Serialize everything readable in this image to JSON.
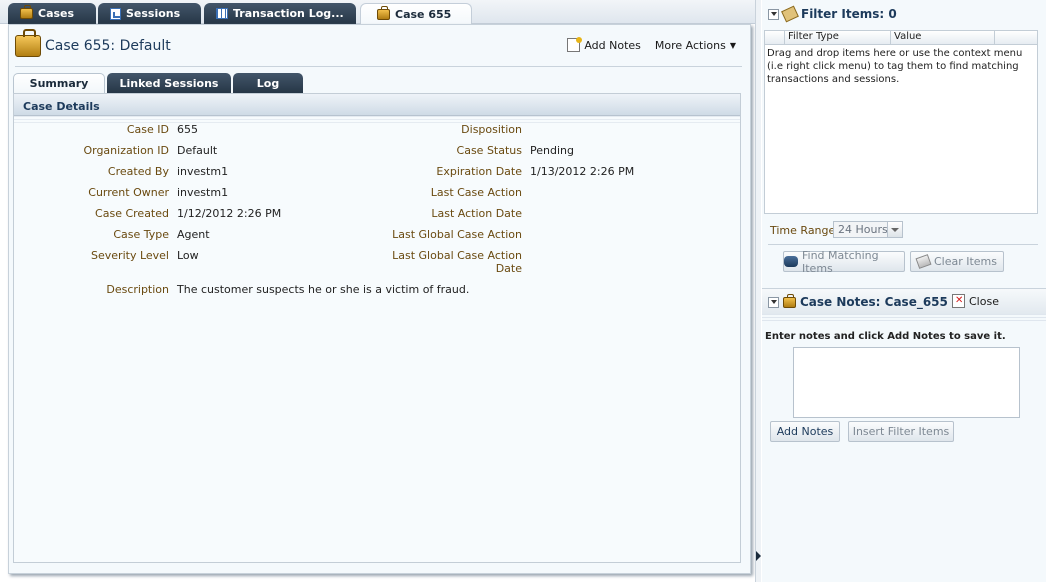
{
  "top_tabs": [
    {
      "label": "Cases",
      "icon": "briefcase-icon"
    },
    {
      "label": "Sessions",
      "icon": "session-document-icon"
    },
    {
      "label": "Transaction Log...",
      "icon": "transaction-log-icon"
    },
    {
      "label": "Case 655",
      "icon": "briefcase-icon"
    }
  ],
  "main": {
    "title": "Case 655: Default",
    "add_notes_label": "Add Notes",
    "more_actions_label": "More Actions",
    "tabs": [
      "Summary",
      "Linked Sessions",
      "Log"
    ],
    "details_header": "Case Details",
    "left_fields": [
      {
        "label": "Case ID",
        "value": "655"
      },
      {
        "label": "Organization ID",
        "value": "Default"
      },
      {
        "label": "Created By",
        "value": "investm1"
      },
      {
        "label": "Current Owner",
        "value": "investm1"
      },
      {
        "label": "Case Created",
        "value": "1/12/2012 2:26 PM"
      },
      {
        "label": "Case Type",
        "value": "Agent"
      },
      {
        "label": "Severity Level",
        "value": "Low"
      },
      {
        "label": "Description",
        "value": "The customer suspects he or she is a victim of fraud."
      }
    ],
    "right_fields": [
      {
        "label": "Disposition",
        "value": ""
      },
      {
        "label": "Case Status",
        "value": "Pending"
      },
      {
        "label": "Expiration Date",
        "value": "1/13/2012 2:26 PM"
      },
      {
        "label": "Last Case Action",
        "value": ""
      },
      {
        "label": "Last Action Date",
        "value": ""
      },
      {
        "label": "Last Global Case Action",
        "value": ""
      },
      {
        "label": "Last Global Case Action Date",
        "value": ""
      }
    ]
  },
  "filter_panel": {
    "title": "Filter Items: 0",
    "columns": [
      "Filter Type",
      "Value"
    ],
    "help_text": "Drag and drop items here or use the context menu (i.e right click menu) to tag them to find matching transactions and sessions.",
    "time_range_label": "Time Range",
    "time_range_value": "24 Hours",
    "find_button": "Find Matching Items",
    "clear_button": "Clear Items"
  },
  "notes_panel": {
    "title": "Case Notes: Case_655",
    "close_label": "Close",
    "instructions": "Enter notes and click Add Notes to save it.",
    "add_notes_button": "Add Notes",
    "insert_filter_button": "Insert Filter Items"
  }
}
